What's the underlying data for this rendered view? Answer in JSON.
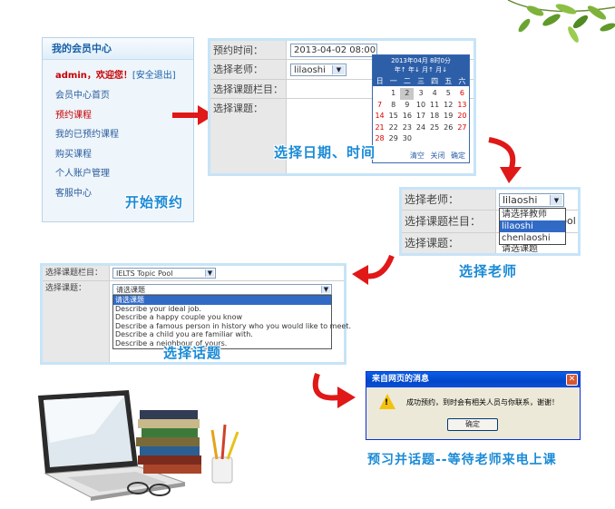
{
  "member_center": {
    "title": "我的会员中心",
    "greeting_user": "admin，欢迎您！",
    "greeting_logout": "[安全退出]",
    "menu": [
      "会员中心首页",
      "预约课程",
      "我的已预约课程",
      "购买课程",
      "个人账户管理",
      "客服中心"
    ],
    "active_index": 1,
    "caption": "开始预约"
  },
  "booking_form": {
    "time_label": "预约时间：",
    "time_value": "2013-04-02 08:00",
    "teacher_label": "选择老师：",
    "teacher_value": "lilaoshi",
    "column_label": "选择课题栏目：",
    "topic_label": "选择课题：",
    "caption": "选择日期、时间"
  },
  "calendar": {
    "header_line1": "2013年04月  8时0分",
    "header_line2": "年↑ 年↓  月↑ 月↓",
    "weekdays": [
      "日",
      "一",
      "二",
      "三",
      "四",
      "五",
      "六"
    ],
    "days": [
      "",
      "1",
      "2",
      "3",
      "4",
      "5",
      "6",
      "7",
      "8",
      "9",
      "10",
      "11",
      "12",
      "13",
      "14",
      "15",
      "16",
      "17",
      "18",
      "19",
      "20",
      "21",
      "22",
      "23",
      "24",
      "25",
      "26",
      "27",
      "28",
      "29",
      "30"
    ],
    "selected_day": "2",
    "footer": [
      "清空",
      "关闭",
      "确定"
    ]
  },
  "teacher_panel": {
    "teacher_label": "选择老师：",
    "teacher_value": "lilaoshi",
    "column_label": "选择课题栏目：",
    "topic_label": "选择课题：",
    "options": [
      "请选择教师",
      "lilaoshi",
      "chenlaoshi"
    ],
    "highlight_index": 1,
    "partial_text_right": "pol",
    "partial_text_topic": "请选课题",
    "caption": "选择老师"
  },
  "topic_panel": {
    "column_label": "选择课题栏目：",
    "column_value": "IELTS Topic Pool",
    "topic_label": "选择课题：",
    "topic_value": "请选课题",
    "options": [
      "请选课题",
      "Describe your ideal job.",
      "Describe a happy couple you know",
      "Describe a famous person in history who you would like to meet.",
      "Describe a child you are familiar with.",
      "Describe a neighbour of yours."
    ],
    "highlight_index": 0,
    "caption": "选择话题"
  },
  "dialog": {
    "title": "来自网页的消息",
    "message": "成功预约，到时会有相关人员与你联系，谢谢！",
    "ok_label": "确定",
    "caption": "预习并话题--等待老师来电上课"
  },
  "colors": {
    "caption_blue": "#1a8ad6",
    "arrow_red": "#e01818",
    "panel_border": "#c7e4f7"
  }
}
